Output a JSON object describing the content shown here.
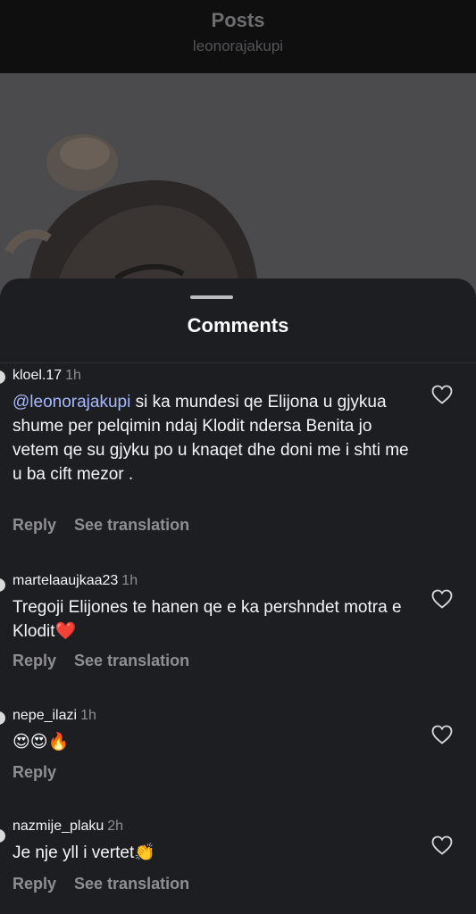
{
  "header": {
    "title": "Posts",
    "username": "leonorajakupi"
  },
  "sheet": {
    "title": "Comments"
  },
  "comments": [
    {
      "user": "kloel.17",
      "time": "1h",
      "mention": "@leonorajakupi",
      "text": " si ka mundesi qe Elijona u gjykua shume per pelqimin ndaj Klodit ndersa Benita jo vetem qe su gjyku po u knaqet dhe doni me i shti me u ba cift mezor .",
      "reply": "Reply",
      "translate": "See translation"
    },
    {
      "user": "martelaaujkaa23",
      "time": "1h",
      "mention": "",
      "text": "Tregoji Elijones te hanen qe e ka pershndet motra e Klodit❤️",
      "reply": "Reply",
      "translate": "See translation"
    },
    {
      "user": "nepe_ilazi",
      "time": "1h",
      "mention": "",
      "text": "😍😍🔥",
      "reply": "Reply",
      "translate": ""
    },
    {
      "user": "nazmije_plaku",
      "time": "2h",
      "mention": "",
      "text": "Je nje yll i vertet👏",
      "reply": "Reply",
      "translate": "See translation"
    }
  ],
  "icons": {
    "like": "heart-icon",
    "drag": "drag-handle"
  },
  "colors": {
    "sheet_bg": "#1d1e22",
    "mention": "#a8b8ff",
    "secondary_text": "#8e8e93"
  }
}
